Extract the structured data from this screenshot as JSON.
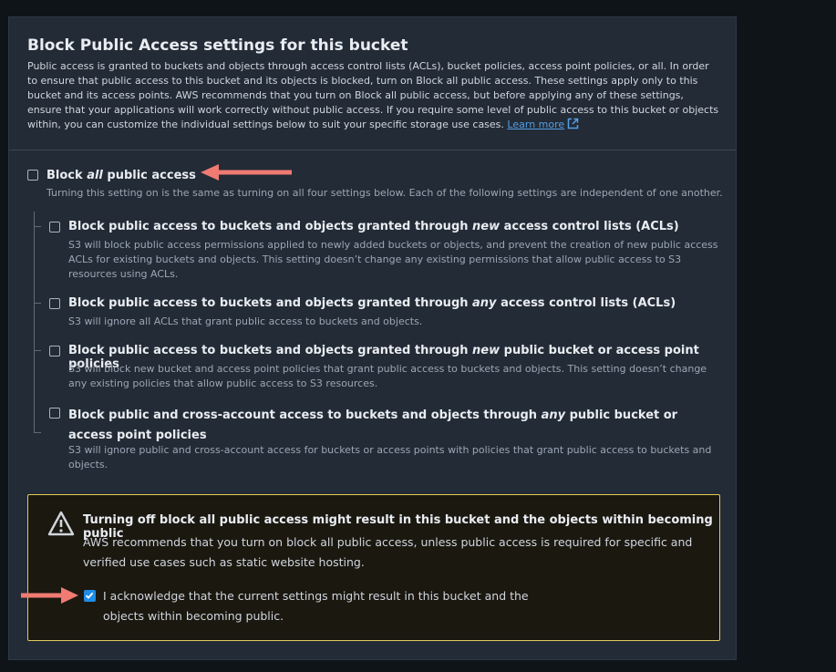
{
  "section": {
    "title": "Block Public Access settings for this bucket",
    "description": "Public access is granted to buckets and objects through access control lists (ACLs), bucket policies, access point policies, or all. In order to ensure that public access to this bucket and its objects is blocked, turn on Block all public access. These settings apply only to this bucket and its access points. AWS recommends that you turn on Block all public access, but before applying any of these settings, ensure that your applications will work correctly without public access. If you require some level of public access to this bucket or objects within, you can customize the individual settings below to suit your specific storage use cases.",
    "learn_more": "Learn more"
  },
  "block_all": {
    "label_pre": "Block ",
    "label_em": "all",
    "label_post": " public access",
    "checked": false,
    "description": "Turning this setting on is the same as turning on all four settings below. Each of the following settings are independent of one another."
  },
  "options": [
    {
      "label_pre": "Block public access to buckets and objects granted through ",
      "label_em": "new",
      "label_post": " access control lists (ACLs)",
      "checked": false,
      "description": "S3 will block public access permissions applied to newly added buckets or objects, and prevent the creation of new public access ACLs for existing buckets and objects. This setting doesn’t change any existing permissions that allow public access to S3 resources using ACLs."
    },
    {
      "label_pre": "Block public access to buckets and objects granted through ",
      "label_em": "any",
      "label_post": " access control lists (ACLs)",
      "checked": false,
      "description": "S3 will ignore all ACLs that grant public access to buckets and objects."
    },
    {
      "label_pre": "Block public access to buckets and objects granted through ",
      "label_em": "new",
      "label_post": " public bucket or access point policies",
      "checked": false,
      "description": "S3 will block new bucket and access point policies that grant public access to buckets and objects. This setting doesn’t change any existing policies that allow public access to S3 resources."
    },
    {
      "label_pre": "Block public and cross-account access to buckets and objects through ",
      "label_em": "any",
      "label_post": " public bucket or access point policies",
      "checked": false,
      "description": "S3 will ignore public and cross-account access for buckets or access points with policies that grant public access to buckets and objects."
    }
  ],
  "warning": {
    "title": "Turning off block all public access might result in this bucket and the objects within becoming public",
    "body": "AWS recommends that you turn on block all public access, unless public access is required for specific and verified use cases such as static website hosting.",
    "acknowledge_label": "I acknowledge that the current settings might result in this bucket and the objects within becoming public.",
    "acknowledge_checked": true
  },
  "colors": {
    "accent": "#1f8ce6",
    "warning_border": "#e0ca57",
    "annotation_arrow": "#f07b72",
    "link": "#539fe5"
  },
  "icons": [
    "external-link-icon",
    "warning-triangle-icon",
    "checkmark-icon",
    "annotation-arrow-icon"
  ]
}
